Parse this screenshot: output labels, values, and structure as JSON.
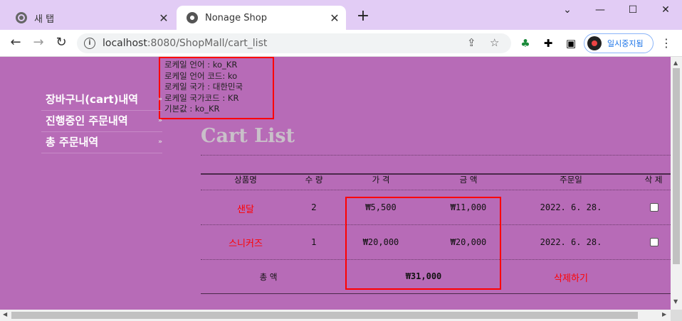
{
  "browser": {
    "tabs": [
      {
        "label": "새 탭",
        "active": false,
        "icon": "chrome-icon"
      },
      {
        "label": "Nonage Shop",
        "active": true,
        "icon": "globe-icon"
      }
    ],
    "new_tab": "+",
    "window_controls": {
      "chevron": "⌄",
      "minimize": "—",
      "maximize": "☐",
      "close": "✕"
    },
    "url_host": "localhost",
    "url_rest": ":8080/ShopMall/cart_list",
    "profile_label": "일시중지됨",
    "icons": {
      "back": "←",
      "forward": "→",
      "reload": "↻",
      "share": "⇪",
      "star": "☆",
      "extension": "✚",
      "sidepanel": "▣",
      "menu": "⋮"
    }
  },
  "locale_info": [
    "로케일 언어 : ko_KR",
    "로케일 언어 코드: ko",
    "로케일 국가 : 대한민국",
    "로케일 국가코드 : KR",
    "기본값 : ko_KR"
  ],
  "side_menu": [
    {
      "label": "장바구니(cart)내역"
    },
    {
      "label": "진행중인 주문내역"
    },
    {
      "label": "총 주문내역"
    }
  ],
  "cart": {
    "title": "Cart List",
    "headers": [
      "상품명",
      "수 량",
      "가 격",
      "금 액",
      "주문일",
      "삭 제"
    ],
    "rows": [
      {
        "name": "샌달",
        "qty": "2",
        "price": "₩5,500",
        "amount": "₩11,000",
        "date": "2022. 6. 28.",
        "checked": false
      },
      {
        "name": "스니커즈",
        "qty": "1",
        "price": "₩20,000",
        "amount": "₩20,000",
        "date": "2022. 6. 28.",
        "checked": false
      }
    ],
    "total_label": "총 액",
    "total_value": "₩31,000",
    "delete_label": "삭제하기"
  }
}
